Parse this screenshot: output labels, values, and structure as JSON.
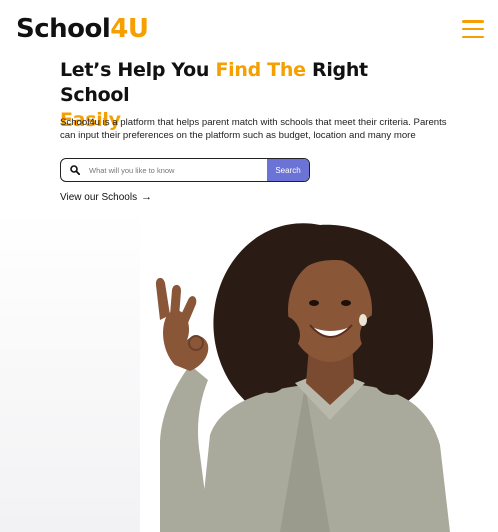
{
  "header": {
    "logo_black": "School",
    "logo_orange": "4U",
    "menu_icon": "hamburger-menu-icon",
    "accent_color": "#f5a000"
  },
  "hero": {
    "headline_1": "Let’s Help You ",
    "headline_highlight_1": "Find The",
    "headline_2": " Right School",
    "headline_highlight_2": "Easily",
    "description": "School4u is a platform that helps parent match with schools that meet their criteria. Parents can input their preferences on the platform such as budget, location and many more",
    "search_placeholder": "What will you like to know",
    "search_button": "Search",
    "search_button_color": "#6b73d6",
    "view_link": "View our Schools",
    "view_link_icon": "arrow-right-icon"
  }
}
